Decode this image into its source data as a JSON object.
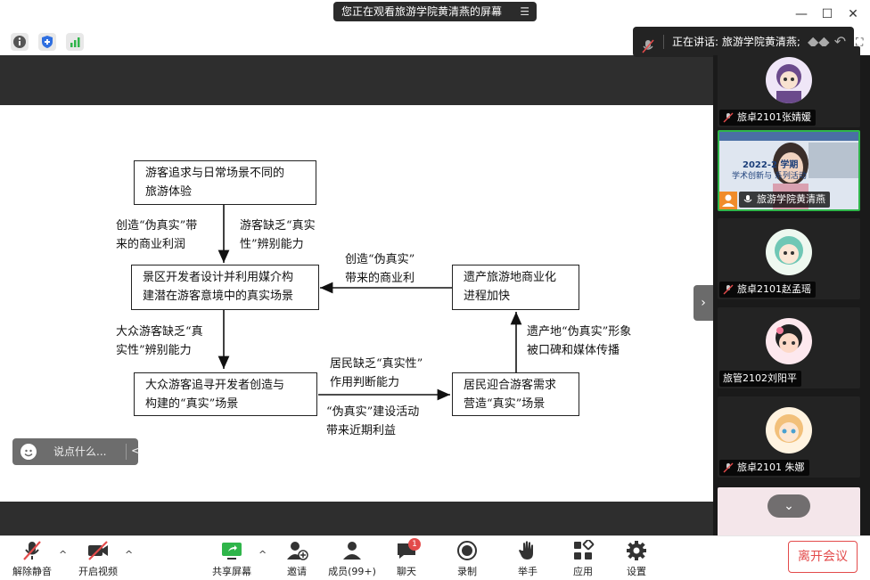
{
  "window": {
    "share_banner": "您正在观看旅游学院黄清燕的屏幕",
    "speaking_label": "正在讲话: 旅游学院黄清燕;"
  },
  "diagram": {
    "box1_line1": "游客追求与日常场景不同的",
    "box1_line2": "旅游体验",
    "box2_line1": "景区开发者设计并利用媒介构",
    "box2_line2": "建潜在游客意境中的真实场景",
    "box3_line1": "遗产旅游地商业化",
    "box3_line2": "进程加快",
    "box4_line1": "大众游客追寻开发者创造与",
    "box4_line2": "构建的“真实”场景",
    "box5_line1": "居民迎合游客需求",
    "box5_line2": "营造“真实”场景",
    "lbl_a_1": "创造“伪真实”带",
    "lbl_a_2": "来的商业利润",
    "lbl_b_1": "游客缺乏“真实",
    "lbl_b_2": "性”辨别能力",
    "lbl_c_1": "创造“伪真实”",
    "lbl_c_2": "带来的商业利",
    "lbl_d_1": "大众游客缺乏“真",
    "lbl_d_2": "实性”辨别能力",
    "lbl_e_1": "遗产地“伪真实”形象",
    "lbl_e_2": "被口碑和媒体传播",
    "lbl_f_1": "居民缺乏“真实性”",
    "lbl_f_2": "作用判断能力",
    "lbl_g_1": "“伪真实”建设活动",
    "lbl_g_2": "带来近期利益"
  },
  "chat_input": {
    "placeholder": "说点什么..."
  },
  "participants": [
    {
      "name": "旅卓2101张婧媛",
      "muted": true
    },
    {
      "name": "旅游学院黄清燕",
      "muted": false,
      "active": true,
      "slide_title": "2022-2 学期",
      "slide_sub": "学术创新与 系列活动"
    },
    {
      "name": "旅卓2101赵孟瑶",
      "muted": true
    },
    {
      "name": "旅管2102刘阳平",
      "muted": false
    },
    {
      "name": "旅卓2101 朱娜",
      "muted": true
    }
  ],
  "toolbar": {
    "unmute": "解除静音",
    "start_video": "开启视频",
    "share_screen": "共享屏幕",
    "invite": "邀请",
    "members": "成员(99+)",
    "chat": "聊天",
    "chat_badge": "1",
    "record": "录制",
    "raise_hand": "举手",
    "apps": "应用",
    "settings": "设置",
    "leave": "离开会议"
  },
  "colors": {
    "accent_green": "#2fb54a",
    "leave_red": "#e34b4b",
    "bar_dark": "#2e2e2e"
  }
}
